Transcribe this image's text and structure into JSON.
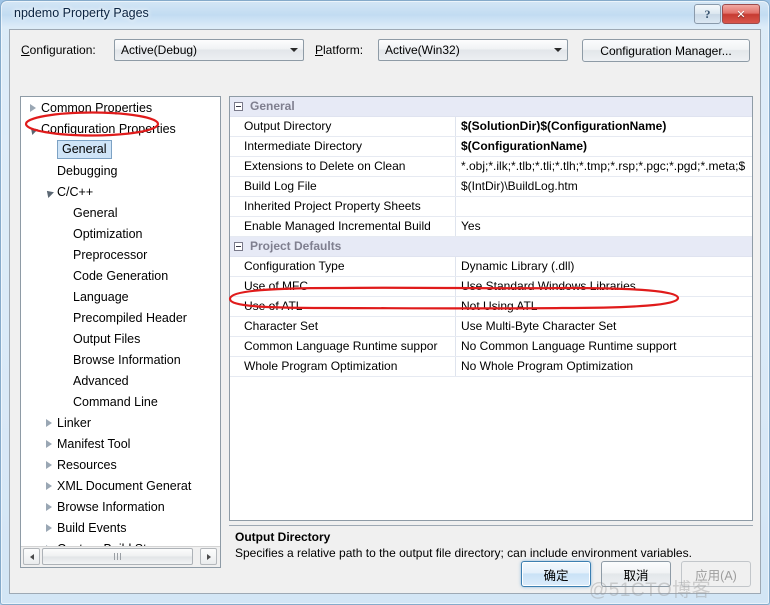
{
  "window": {
    "title": "npdemo Property Pages",
    "help_button": "?",
    "close_button": "✕"
  },
  "toolbar": {
    "configuration_label": "Configuration:",
    "configuration_value": "Active(Debug)",
    "platform_label": "Platform:",
    "platform_value": "Active(Win32)",
    "configuration_manager_label": "Configuration Manager..."
  },
  "tree": {
    "items": [
      {
        "label": "Common Properties",
        "indent": 0,
        "state": "collapsed",
        "selected": false
      },
      {
        "label": "Configuration Properties",
        "indent": 0,
        "state": "expanded",
        "selected": false
      },
      {
        "label": "General",
        "indent": 1,
        "state": "leaf",
        "selected": true
      },
      {
        "label": "Debugging",
        "indent": 1,
        "state": "leaf",
        "selected": false
      },
      {
        "label": "C/C++",
        "indent": 1,
        "state": "expanded",
        "selected": false
      },
      {
        "label": "General",
        "indent": 2,
        "state": "leaf",
        "selected": false
      },
      {
        "label": "Optimization",
        "indent": 2,
        "state": "leaf",
        "selected": false
      },
      {
        "label": "Preprocessor",
        "indent": 2,
        "state": "leaf",
        "selected": false
      },
      {
        "label": "Code Generation",
        "indent": 2,
        "state": "leaf",
        "selected": false
      },
      {
        "label": "Language",
        "indent": 2,
        "state": "leaf",
        "selected": false
      },
      {
        "label": "Precompiled Header",
        "indent": 2,
        "state": "leaf",
        "selected": false
      },
      {
        "label": "Output Files",
        "indent": 2,
        "state": "leaf",
        "selected": false
      },
      {
        "label": "Browse Information",
        "indent": 2,
        "state": "leaf",
        "selected": false
      },
      {
        "label": "Advanced",
        "indent": 2,
        "state": "leaf",
        "selected": false
      },
      {
        "label": "Command Line",
        "indent": 2,
        "state": "leaf",
        "selected": false
      },
      {
        "label": "Linker",
        "indent": 1,
        "state": "collapsed",
        "selected": false
      },
      {
        "label": "Manifest Tool",
        "indent": 1,
        "state": "collapsed",
        "selected": false
      },
      {
        "label": "Resources",
        "indent": 1,
        "state": "collapsed",
        "selected": false
      },
      {
        "label": "XML Document Generat",
        "indent": 1,
        "state": "collapsed",
        "selected": false
      },
      {
        "label": "Browse Information",
        "indent": 1,
        "state": "collapsed",
        "selected": false
      },
      {
        "label": "Build Events",
        "indent": 1,
        "state": "collapsed",
        "selected": false
      },
      {
        "label": "Custom Build Step",
        "indent": 1,
        "state": "collapsed",
        "selected": false
      }
    ],
    "hscrollbar": {
      "left_arrow": "◄",
      "right_arrow": "►"
    }
  },
  "grid": {
    "rows": [
      {
        "kind": "category",
        "name": "General",
        "value": ""
      },
      {
        "kind": "prop",
        "name": "Output Directory",
        "value": "$(SolutionDir)$(ConfigurationName)",
        "bold": true,
        "selected": true
      },
      {
        "kind": "prop",
        "name": "Intermediate Directory",
        "value": "$(ConfigurationName)",
        "bold": true
      },
      {
        "kind": "prop",
        "name": "Extensions to Delete on Clean",
        "value": "*.obj;*.ilk;*.tlb;*.tli;*.tlh;*.tmp;*.rsp;*.pgc;*.pgd;*.meta;$"
      },
      {
        "kind": "prop",
        "name": "Build Log File",
        "value": "$(IntDir)\\BuildLog.htm"
      },
      {
        "kind": "prop",
        "name": "Inherited Project Property Sheets",
        "value": ""
      },
      {
        "kind": "prop",
        "name": "Enable Managed Incremental Build",
        "value": "Yes"
      },
      {
        "kind": "category",
        "name": "Project Defaults",
        "value": ""
      },
      {
        "kind": "prop",
        "name": "Configuration Type",
        "value": "Dynamic Library (.dll)"
      },
      {
        "kind": "prop",
        "name": "Use of MFC",
        "value": "Use Standard Windows Libraries"
      },
      {
        "kind": "prop",
        "name": "Use of ATL",
        "value": "Not Using ATL"
      },
      {
        "kind": "prop",
        "name": "Character Set",
        "value": "Use Multi-Byte Character Set"
      },
      {
        "kind": "prop",
        "name": "Common Language Runtime suppor",
        "value": "No Common Language Runtime support"
      },
      {
        "kind": "prop",
        "name": "Whole Program Optimization",
        "value": "No Whole Program Optimization"
      }
    ]
  },
  "description": {
    "title": "Output Directory",
    "body": "Specifies a relative path to the output file directory; can include environment variables."
  },
  "buttons": {
    "ok": "确定",
    "cancel": "取消",
    "apply": "应用(A)"
  },
  "watermark": {
    "text": "@51CTO博客"
  },
  "colors": {
    "annotation": "#e01b1b",
    "category_bg": "#e7eaf6",
    "selection": "#cfe4f7",
    "titlebar_text": "#0b2340",
    "close_button": "#c63b32"
  }
}
